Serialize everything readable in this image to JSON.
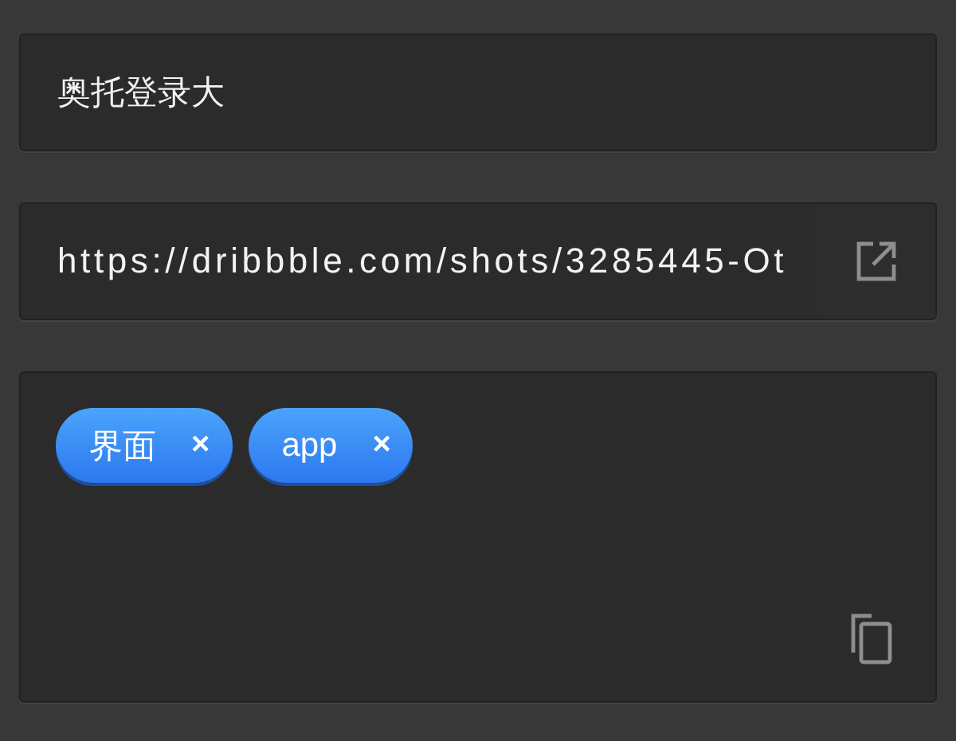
{
  "title_field": {
    "value": "奥托登录大"
  },
  "url_field": {
    "value": "https://dribbble.com/shots/3285445-Ot",
    "kind": "link"
  },
  "tag_box": {
    "kind": "copyable",
    "tags": [
      {
        "label": "界面",
        "remove": "×"
      },
      {
        "label": "app",
        "remove": "×"
      }
    ]
  }
}
